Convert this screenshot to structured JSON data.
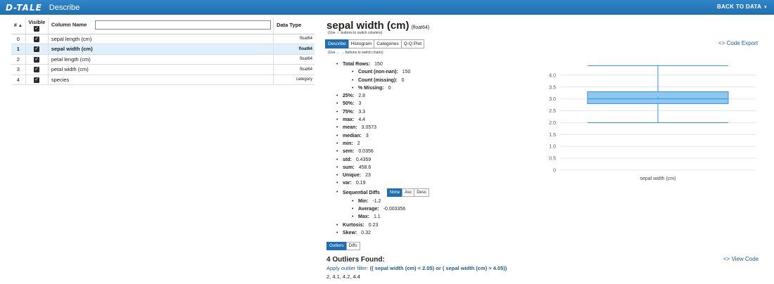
{
  "header": {
    "logo": "D-TALE",
    "title": "Describe",
    "back_label": "BACK TO DATA",
    "back_caret": "▾"
  },
  "columns_table": {
    "headers": {
      "index": "#",
      "index_sort": "▲",
      "visible": "Visible",
      "name": "Column Name",
      "type": "Data Type"
    },
    "filter_value": "",
    "rows": [
      {
        "index": "0",
        "name": "sepal length (cm)",
        "type": "float64",
        "visible": true,
        "selected": false
      },
      {
        "index": "1",
        "name": "sepal width (cm)",
        "type": "float64",
        "visible": true,
        "selected": true
      },
      {
        "index": "2",
        "name": "petal length (cm)",
        "type": "float64",
        "visible": true,
        "selected": false
      },
      {
        "index": "3",
        "name": "petal width (cm)",
        "type": "float64",
        "visible": true,
        "selected": false
      },
      {
        "index": "4",
        "name": "species",
        "type": "category",
        "visible": true,
        "selected": false
      }
    ]
  },
  "detail": {
    "column": "sepal width (cm)",
    "dtype": "(float64)",
    "hint_columns": "(Use ↑↓ buttons to switch columns)",
    "hint_charts": "(Use ← → buttons to switch charts)",
    "tabs": [
      "Describe",
      "Histogram",
      "Categories",
      "Q-Q Plot"
    ],
    "active_tab": "Describe",
    "code_export": "<> Code Export",
    "stats": {
      "total_rows_label": "Total Rows:",
      "total_rows": "150",
      "count_label": "Count (non-nan):",
      "count": "150",
      "missing_label": "Count (missing):",
      "missing": "0",
      "pct_missing_label": "% Missing:",
      "pct_missing": "0",
      "p25_label": "25%:",
      "p25": "2.8",
      "p50_label": "50%:",
      "p50": "3",
      "p75_label": "75%:",
      "p75": "3.3",
      "max_label": "max:",
      "max": "4.4",
      "mean_label": "mean:",
      "mean": "3.0573",
      "median_label": "median:",
      "median": "3",
      "min_label": "min:",
      "min": "2",
      "sem_label": "sem:",
      "sem": "0.0356",
      "std_label": "std:",
      "std": "0.4359",
      "sum_label": "sum:",
      "sum": "458.6",
      "unique_label": "Unique:",
      "unique": "23",
      "var_label": "var:",
      "var": "0.19",
      "seq_label": "Sequential Diffs",
      "seq_buttons": [
        "None",
        "Asc",
        "Desc"
      ],
      "seq_min_label": "Min:",
      "seq_min": "-1.2",
      "seq_avg_label": "Average:",
      "seq_avg": "-0.003356",
      "seq_max_label": "Max:",
      "seq_max": "1.1",
      "kurtosis_label": "Kurtosis:",
      "kurtosis": "0.23",
      "skew_label": "Skew:",
      "skew": "0.32"
    },
    "outlier_tabs": [
      "Outliers",
      "Diffs"
    ],
    "outliers_title": "4 Outliers Found:",
    "outlier_filter_prefix": "Apply outlier filter: ",
    "outlier_filter": "(( sepal width (cm)  < 2.05) or ( sepal width (cm)  > 4.05))",
    "outlier_values": "2, 4.1, 4.2, 4.4",
    "view_code": "<> View Code"
  },
  "chart_data": {
    "type": "box",
    "xlabel": "sepal width (cm)",
    "y_ticks": [
      "0",
      "0.5",
      "1.0",
      "1.5",
      "2.0",
      "2.5",
      "3.0",
      "3.5",
      "4.0"
    ],
    "ylim": [
      0,
      4.5
    ],
    "box": {
      "min": 2.0,
      "q1": 2.8,
      "median": 3.0,
      "q3": 3.3,
      "max": 4.4,
      "mean": 3.0573
    },
    "colors": {
      "box_fill": "#8cc8f0",
      "box_stroke": "#3a8fd0",
      "grid": "#e6e6e6"
    }
  }
}
